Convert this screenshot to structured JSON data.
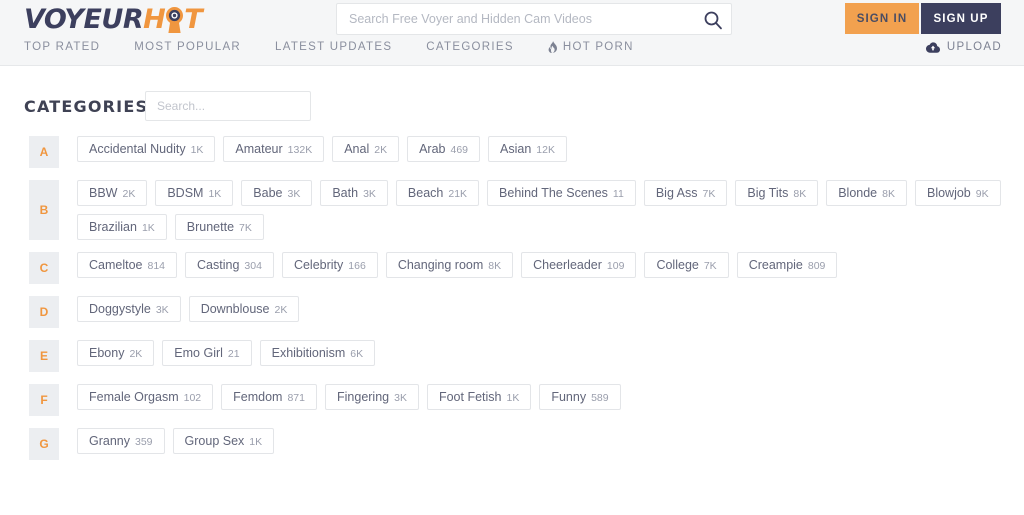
{
  "header": {
    "logo": {
      "part1": "VOYEUR",
      "part2_pre": "H",
      "part2_post": "T",
      "eye_icon": "keyhole-camera-icon"
    },
    "search": {
      "placeholder": "Search Free Voyer and Hidden Cam Videos",
      "value": "",
      "icon": "search-icon"
    },
    "sign_in": "SIGN IN",
    "sign_up": "SIGN UP",
    "nav": [
      {
        "label": "TOP RATED",
        "icon": null
      },
      {
        "label": "MOST POPULAR",
        "icon": null
      },
      {
        "label": "LATEST UPDATES",
        "icon": null
      },
      {
        "label": "CATEGORIES",
        "icon": null
      },
      {
        "label": "HOT PORN",
        "icon": "flame-icon"
      }
    ],
    "upload": {
      "label": "UPLOAD",
      "icon": "cloud-upload-icon"
    }
  },
  "page": {
    "title": "CATEGORIES",
    "filter": {
      "placeholder": "Search...",
      "value": ""
    }
  },
  "colors": {
    "accent_orange": "#f0963f",
    "dark_navy": "#3c3f5e",
    "header_bg": "#f5f6f7",
    "letter_bg": "#eceef1",
    "tag_border": "#e3e5e8"
  },
  "groups": [
    {
      "letter": "A",
      "tags": [
        {
          "label": "Accidental Nudity",
          "count": "1K"
        },
        {
          "label": "Amateur",
          "count": "132K"
        },
        {
          "label": "Anal",
          "count": "2K"
        },
        {
          "label": "Arab",
          "count": "469"
        },
        {
          "label": "Asian",
          "count": "12K"
        }
      ]
    },
    {
      "letter": "B",
      "tags": [
        {
          "label": "BBW",
          "count": "2K"
        },
        {
          "label": "BDSM",
          "count": "1K"
        },
        {
          "label": "Babe",
          "count": "3K"
        },
        {
          "label": "Bath",
          "count": "3K"
        },
        {
          "label": "Beach",
          "count": "21K"
        },
        {
          "label": "Behind The Scenes",
          "count": "11"
        },
        {
          "label": "Big Ass",
          "count": "7K"
        },
        {
          "label": "Big Tits",
          "count": "8K"
        },
        {
          "label": "Blonde",
          "count": "8K"
        },
        {
          "label": "Blowjob",
          "count": "9K"
        },
        {
          "label": "Brazilian",
          "count": "1K"
        },
        {
          "label": "Brunette",
          "count": "7K"
        }
      ]
    },
    {
      "letter": "C",
      "tags": [
        {
          "label": "Cameltoe",
          "count": "814"
        },
        {
          "label": "Casting",
          "count": "304"
        },
        {
          "label": "Celebrity",
          "count": "166"
        },
        {
          "label": "Changing room",
          "count": "8K"
        },
        {
          "label": "Cheerleader",
          "count": "109"
        },
        {
          "label": "College",
          "count": "7K"
        },
        {
          "label": "Creampie",
          "count": "809"
        }
      ]
    },
    {
      "letter": "D",
      "tags": [
        {
          "label": "Doggystyle",
          "count": "3K"
        },
        {
          "label": "Downblouse",
          "count": "2K"
        }
      ]
    },
    {
      "letter": "E",
      "tags": [
        {
          "label": "Ebony",
          "count": "2K"
        },
        {
          "label": "Emo Girl",
          "count": "21"
        },
        {
          "label": "Exhibitionism",
          "count": "6K"
        }
      ]
    },
    {
      "letter": "F",
      "tags": [
        {
          "label": "Female Orgasm",
          "count": "102"
        },
        {
          "label": "Femdom",
          "count": "871"
        },
        {
          "label": "Fingering",
          "count": "3K"
        },
        {
          "label": "Foot Fetish",
          "count": "1K"
        },
        {
          "label": "Funny",
          "count": "589"
        }
      ]
    },
    {
      "letter": "G",
      "tags": [
        {
          "label": "Granny",
          "count": "359"
        },
        {
          "label": "Group Sex",
          "count": "1K"
        }
      ]
    }
  ]
}
